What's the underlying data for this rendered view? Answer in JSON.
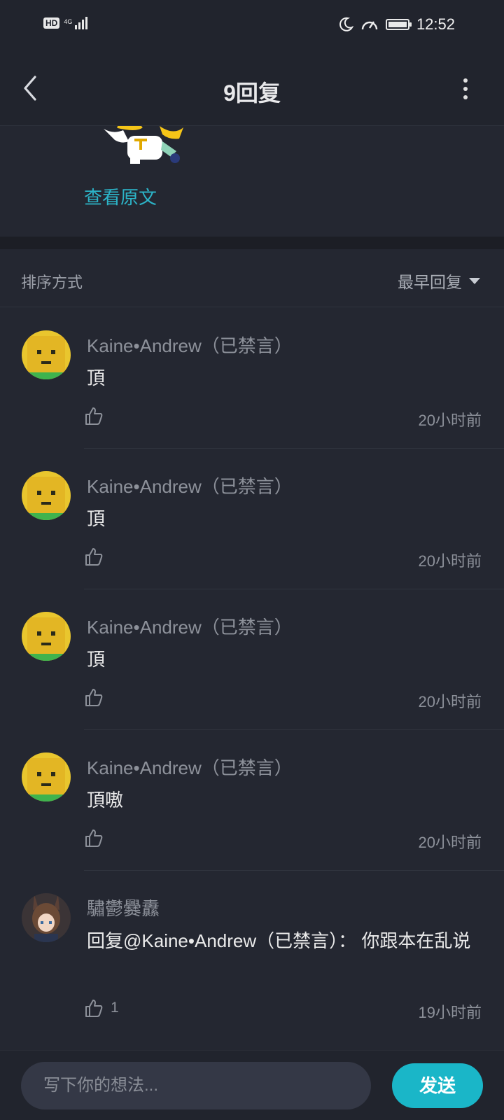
{
  "status_bar": {
    "hd": "HD",
    "network": "4G",
    "time": "12:52"
  },
  "header": {
    "title": "9回复"
  },
  "original_post": {
    "view_original": "查看原文"
  },
  "sort": {
    "label": "排序方式",
    "selected": "最早回复"
  },
  "comments": [
    {
      "user": "Kaine•Andrew（已禁言）",
      "text": "頂",
      "likes": "",
      "time": "20小时前"
    },
    {
      "user": "Kaine•Andrew（已禁言）",
      "text": "頂",
      "likes": "",
      "time": "20小时前"
    },
    {
      "user": "Kaine•Andrew（已禁言）",
      "text": "頂",
      "likes": "",
      "time": "20小时前"
    },
    {
      "user": "Kaine•Andrew（已禁言）",
      "text": "頂嗷",
      "likes": "",
      "time": "20小时前"
    },
    {
      "user": "驌鬱爨纛",
      "text": "回复@Kaine•Andrew（已禁言）：  你跟本在乱说",
      "likes": "1",
      "time": "19小时前"
    }
  ],
  "composer": {
    "placeholder": "写下你的想法...",
    "send": "发送"
  },
  "colors": {
    "background": "#242731",
    "accent": "#1ab6c8",
    "link": "#2cb4c8"
  }
}
